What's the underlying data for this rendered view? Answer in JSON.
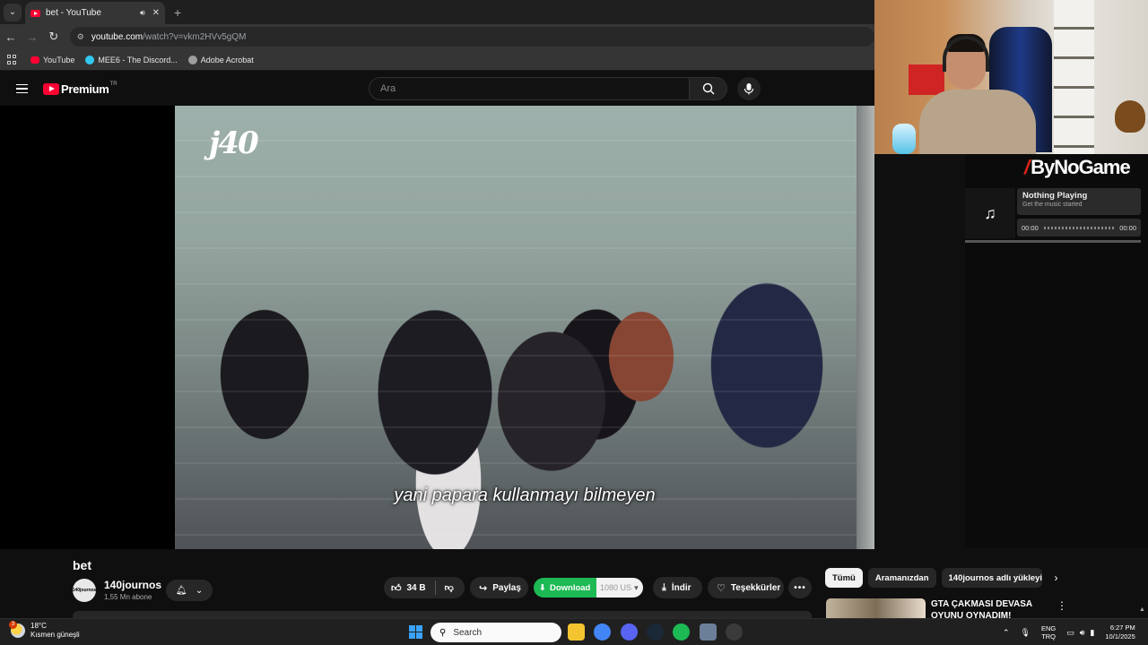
{
  "browser": {
    "tab": {
      "title": "bet - YouTube",
      "mute_icon": "speaker-icon",
      "close_icon": "close-icon"
    },
    "new_tab": "+",
    "url_host": "youtube.com",
    "url_path": "/watch?v=vkm2HVv5gQM",
    "bookmarks": [
      {
        "label": "YouTube",
        "color": "#ff0033"
      },
      {
        "label": "MEE6 - The Discord...",
        "color": "#31c9f0"
      },
      {
        "label": "Adobe Acrobat",
        "color": "#9e9e9e"
      }
    ]
  },
  "youtube": {
    "logo_text": "Premium",
    "logo_region": "TR",
    "search_placeholder": "Ara"
  },
  "video": {
    "watermark": "j40",
    "subtitle": "yani papara kullanmayı bilmeyen",
    "title": "bet",
    "channel": {
      "name": "140journos",
      "subscribers": "1,55 Mn abone",
      "avatar_text": "140journos"
    },
    "actions": {
      "likes": "34 B",
      "share": "Paylaş",
      "download": "Download",
      "download_quality": "1080",
      "download_quality_suffix": "US",
      "indir": "İndir",
      "thanks": "Teşekkürler",
      "more": "•••"
    }
  },
  "sidebar": {
    "chips": [
      "Tümü",
      "Aramanızdan",
      "140journos adlı yükleyici"
    ],
    "recommended": [
      {
        "title": "GTA ÇAKMASI DEVASA OYUNU OYNADIM!"
      }
    ]
  },
  "music_widget": {
    "brand": "ByNoGame",
    "track_title": "Nothing Playing",
    "track_sub": "Get the music started",
    "time_start": "00:00",
    "time_end": "00:00",
    "progress": 0
  },
  "taskbar": {
    "weather_badge": "3",
    "temperature": "18°C",
    "condition": "Kısmen güneşli",
    "search_label": "Search",
    "apps": [
      {
        "name": "file-explorer-icon",
        "color": "#f4c430"
      },
      {
        "name": "chrome-icon",
        "color": "#4285f4"
      },
      {
        "name": "discord-icon",
        "color": "#5865f2"
      },
      {
        "name": "steam-icon",
        "color": "#1b2838"
      },
      {
        "name": "spotify-icon",
        "color": "#1db954"
      },
      {
        "name": "app-icon",
        "color": "#6b7f99"
      },
      {
        "name": "obs-icon",
        "color": "#3a3a3a"
      }
    ],
    "lang_line1": "ENG",
    "lang_line2": "TRQ",
    "time": "6:27 PM",
    "date": "10/1/2025"
  }
}
